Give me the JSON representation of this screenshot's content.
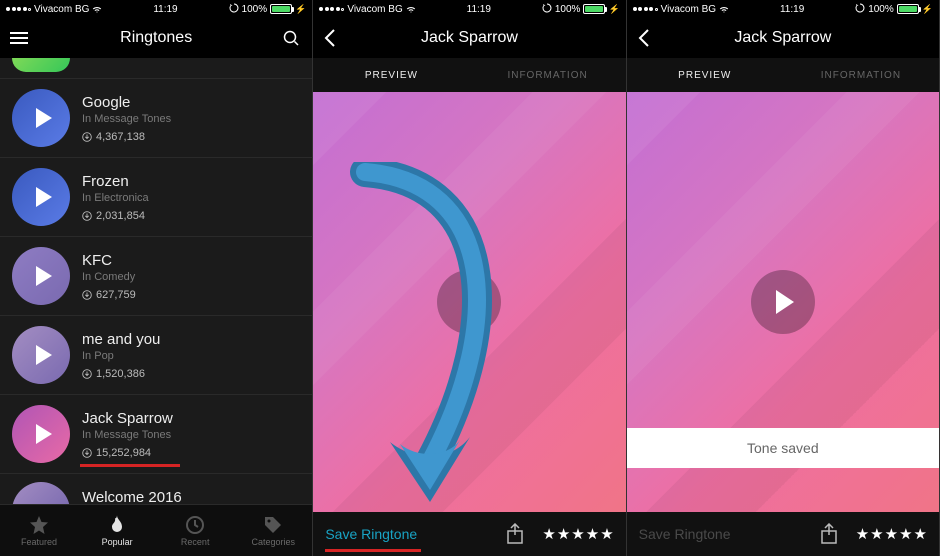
{
  "status": {
    "carrier": "Vivacom BG",
    "time": "11:19",
    "battery_pct": "100%"
  },
  "screen1": {
    "title": "Ringtones",
    "items": [
      {
        "title": "Google",
        "sub": "In Message Tones",
        "downloads": "4,367,138",
        "thumb": "blue"
      },
      {
        "title": "Frozen",
        "sub": "In Electronica",
        "downloads": "2,031,854",
        "thumb": "blue"
      },
      {
        "title": "KFC",
        "sub": "In Comedy",
        "downloads": "627,759",
        "thumb": "purple"
      },
      {
        "title": "me and you",
        "sub": "In Pop",
        "downloads": "1,520,386",
        "thumb": "pop"
      },
      {
        "title": "Jack Sparrow",
        "sub": "In Message Tones",
        "downloads": "15,252,984",
        "thumb": "pink",
        "underline": true
      }
    ],
    "peek_title": "Welcome 2016",
    "tabs": {
      "featured": "Featured",
      "popular": "Popular",
      "recent": "Recent",
      "categories": "Categories",
      "active": "popular"
    }
  },
  "screen2": {
    "title": "Jack Sparrow",
    "segments": {
      "preview": "PREVIEW",
      "information": "INFORMATION",
      "active": "preview"
    },
    "save_label": "Save Ringtone",
    "rating": 5
  },
  "screen3": {
    "title": "Jack Sparrow",
    "segments": {
      "preview": "PREVIEW",
      "information": "INFORMATION",
      "active": "preview"
    },
    "save_label": "Save Ringtone",
    "toast": "Tone saved",
    "rating": 5
  }
}
